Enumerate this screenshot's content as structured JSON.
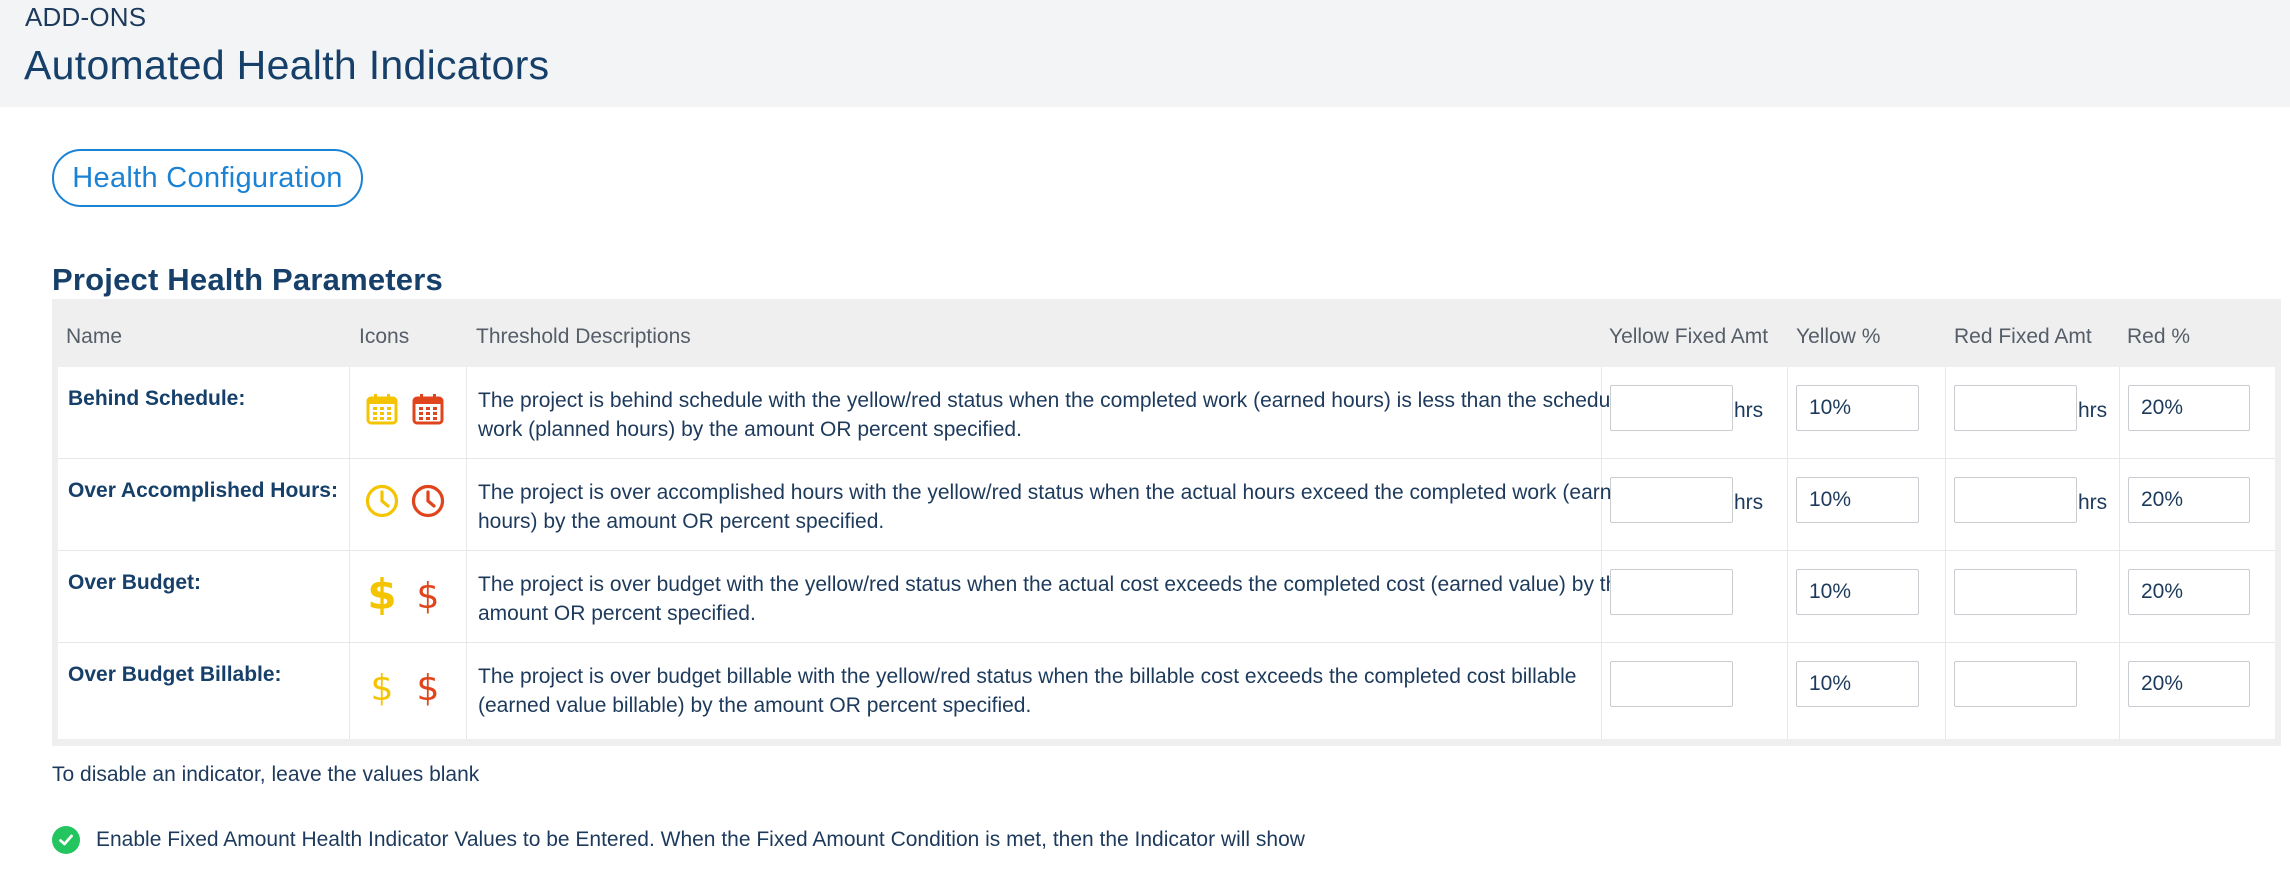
{
  "header": {
    "breadcrumb": "ADD-ONS",
    "title": "Automated Health Indicators"
  },
  "config_button": "Health Configuration",
  "section_title": "Project Health Parameters",
  "table": {
    "headers": {
      "name": "Name",
      "icons": "Icons",
      "threshold": "Threshold Descriptions",
      "yellow_fixed": "Yellow Fixed Amt",
      "yellow_pct": "Yellow %",
      "red_fixed": "Red Fixed Amt",
      "red_pct": "Red %"
    },
    "rows": [
      {
        "name": "Behind Schedule:",
        "icons": [
          "calendar-yellow-icon",
          "calendar-red-icon"
        ],
        "description": "The project is behind schedule with the yellow/red status when the completed work (earned hours) is less than the scheduled work (planned hours) by the amount OR percent specified.",
        "yellow_fixed": "",
        "yellow_unit": "hrs",
        "yellow_pct": "10%",
        "red_fixed": "",
        "red_unit": "hrs",
        "red_pct": "20%"
      },
      {
        "name": "Over Accomplished Hours:",
        "icons": [
          "clock-yellow-icon",
          "clock-red-icon"
        ],
        "description": "The project is over accomplished hours with the yellow/red status when the actual hours exceed the completed work (earned hours) by the amount OR percent specified.",
        "yellow_fixed": "",
        "yellow_unit": "hrs",
        "yellow_pct": "10%",
        "red_fixed": "",
        "red_unit": "hrs",
        "red_pct": "20%"
      },
      {
        "name": "Over Budget:",
        "icons": [
          "dollar-bold-yellow-icon",
          "dollar-red-icon"
        ],
        "description": "The project is over budget with the yellow/red status when the actual cost exceeds the completed cost (earned value) by the amount OR percent specified.",
        "yellow_fixed": "",
        "yellow_pct": "10%",
        "red_fixed": "",
        "red_pct": "20%"
      },
      {
        "name": "Over Budget Billable:",
        "icons": [
          "dollar-yellow-icon",
          "dollar-red-icon"
        ],
        "description": "The project is over budget billable with the yellow/red status when the billable cost exceeds the completed cost billable (earned value billable) by the amount OR percent specified.",
        "yellow_fixed": "",
        "yellow_pct": "10%",
        "red_fixed": "",
        "red_pct": "20%"
      }
    ]
  },
  "note": "To disable an indicator, leave the values blank",
  "fixed_amount_option": {
    "checked": true,
    "label": "Enable Fixed Amount Health Indicator Values to be Entered. When the Fixed Amount Condition is met, then the Indicator will show"
  },
  "colors": {
    "accent": "#1c83d4",
    "title": "#16406a",
    "yellow": "#f5c400",
    "red": "#e0441c",
    "check": "#22c55e"
  }
}
